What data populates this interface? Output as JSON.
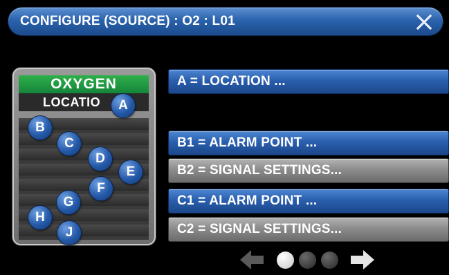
{
  "header": {
    "title": "CONFIGURE (SOURCE) : O2 : L01"
  },
  "panel": {
    "gas_label": "OXYGEN",
    "location_label": "LOCATIO",
    "badges": {
      "a": "A",
      "b": "B",
      "c": "C",
      "d": "D",
      "e": "E",
      "f": "F",
      "g": "G",
      "h": "H",
      "j": "J"
    }
  },
  "menu": {
    "a": "A = LOCATION ...",
    "b1": "B1 = ALARM POINT ...",
    "b2": "B2 = SIGNAL SETTINGS...",
    "c1": "C1 = ALARM POINT ...",
    "c2": "C2 = SIGNAL SETTINGS..."
  },
  "pager": {
    "total_pages": 3,
    "current_page": 1
  },
  "colors": {
    "accent_blue": "#2a5fae",
    "gas_green": "#14853a",
    "disabled_gray": "#8c8c8c"
  },
  "icons": {
    "close": "close-icon",
    "prev": "arrow-left-icon",
    "next": "arrow-right-icon"
  }
}
